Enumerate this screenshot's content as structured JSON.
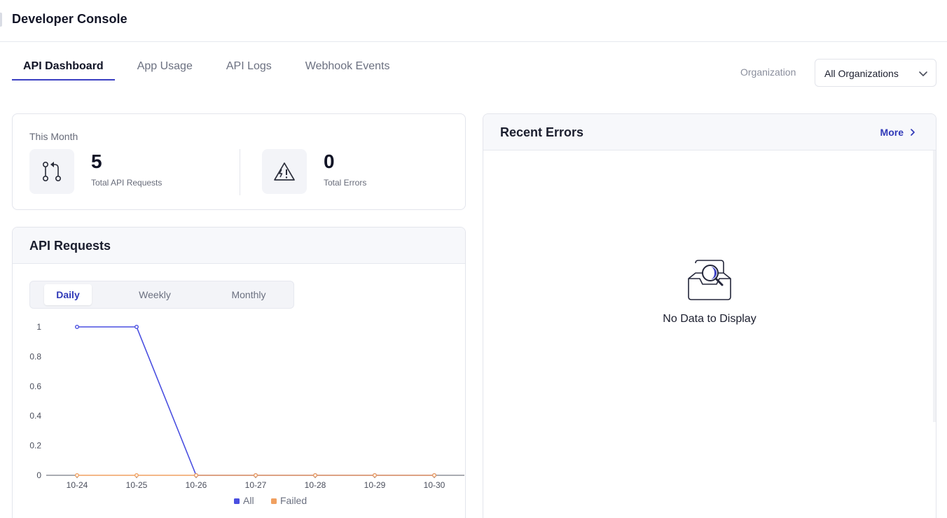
{
  "app": {
    "title": "Developer Console"
  },
  "tabs": [
    {
      "label": "API Dashboard",
      "active": true
    },
    {
      "label": "App Usage",
      "active": false
    },
    {
      "label": "API Logs",
      "active": false
    },
    {
      "label": "Webhook Events",
      "active": false
    }
  ],
  "organization": {
    "label": "Organization",
    "selected": "All Organizations"
  },
  "summary": {
    "period": "This Month",
    "stats": [
      {
        "value": "5",
        "label": "Total API Requests",
        "icon": "git-pull-request-icon"
      },
      {
        "value": "0",
        "label": "Total Errors",
        "icon": "warning-icon"
      }
    ]
  },
  "requests": {
    "title": "API Requests",
    "ranges": [
      "Daily",
      "Weekly",
      "Monthly"
    ],
    "active_range": "Daily"
  },
  "chart_data": {
    "type": "line",
    "x": [
      "10-24",
      "10-25",
      "10-26",
      "10-27",
      "10-28",
      "10-29",
      "10-30"
    ],
    "yticks": [
      "0",
      "0.2",
      "0.4",
      "0.6",
      "0.8",
      "1"
    ],
    "ylim": [
      0,
      1
    ],
    "series": [
      {
        "name": "All",
        "values": [
          1,
          1,
          0,
          0,
          0,
          0,
          0
        ],
        "color": "#4a4fe0"
      },
      {
        "name": "Failed",
        "values": [
          0,
          0,
          0,
          0,
          0,
          0,
          0
        ],
        "color": "#f0a060"
      }
    ],
    "legend": "bottom-center",
    "grid": false
  },
  "errors": {
    "title": "Recent Errors",
    "more_label": "More",
    "empty_text": "No Data to Display",
    "empty_icon": "search-inbox-icon"
  },
  "colors": {
    "accent": "#3039b8",
    "all_series": "#4a4fe0",
    "failed_series": "#f0a060"
  }
}
